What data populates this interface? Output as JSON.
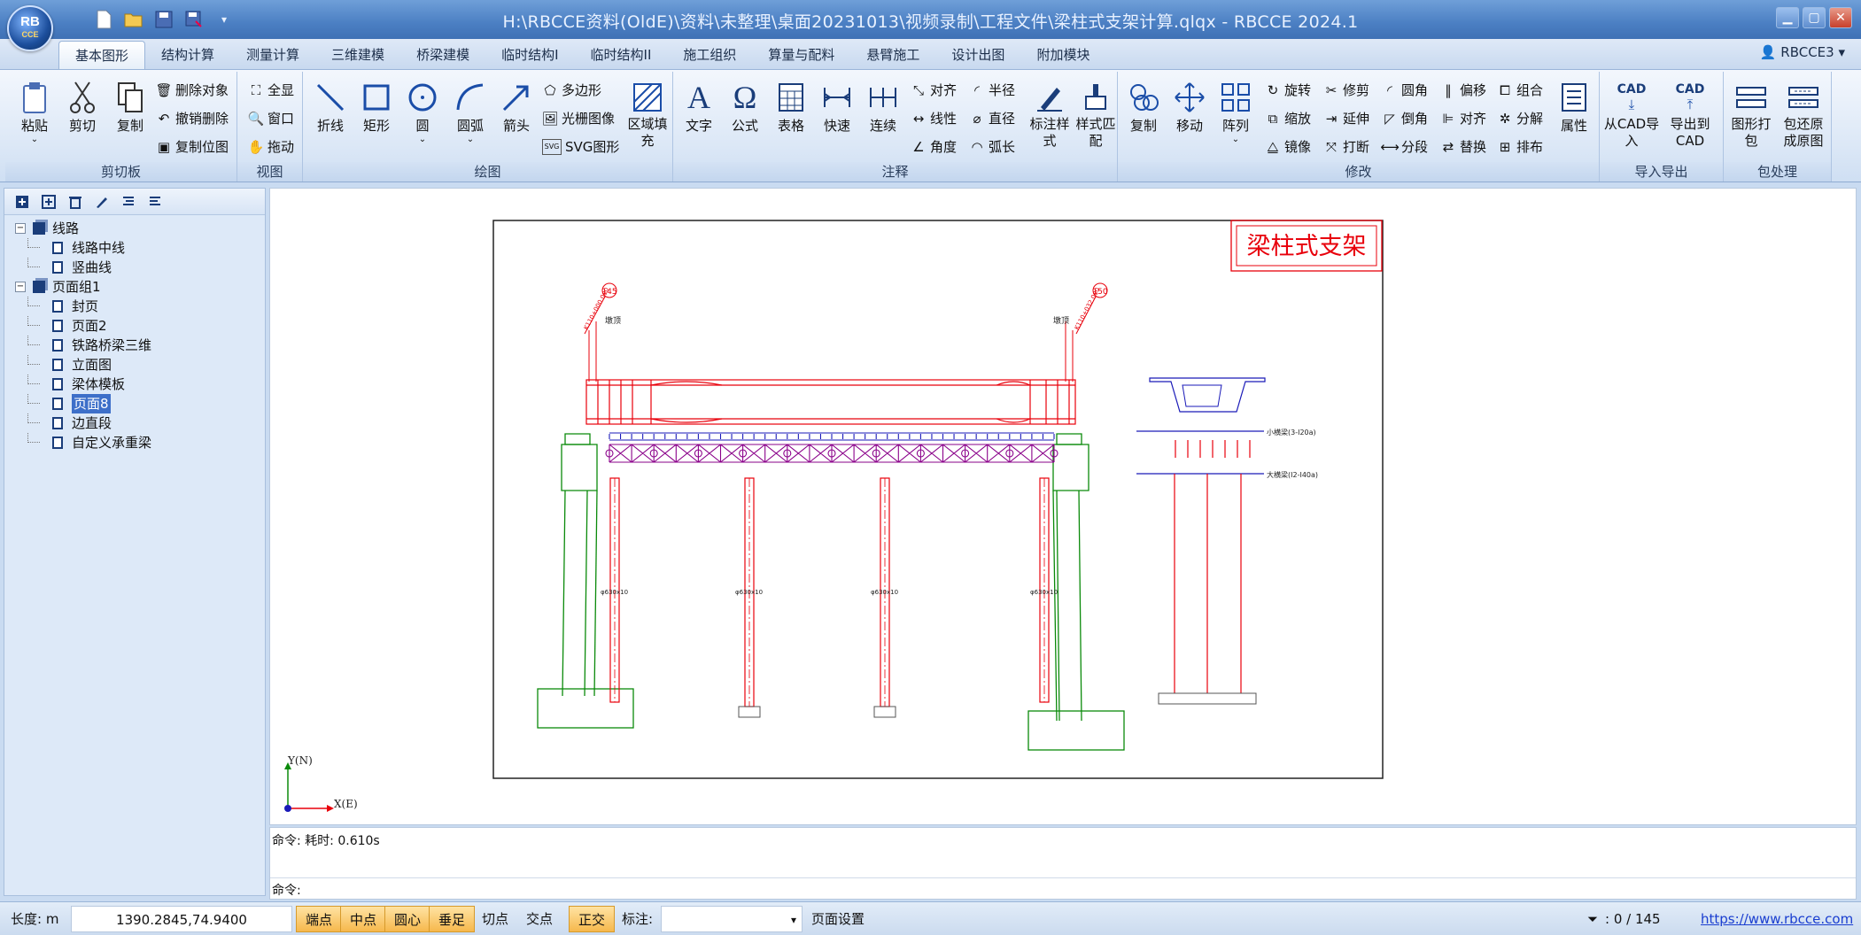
{
  "app": {
    "title": "H:\\RBCCE资料(OldE)\\资料\\未整理\\桌面20231013\\视频录制\\工程文件\\梁柱式支架计算.qlqx - RBCCE 2024.1",
    "logo_text": "RB",
    "logo_sub": "CCE"
  },
  "menu": {
    "tabs": [
      "基本图形",
      "结构计算",
      "测量计算",
      "三维建模",
      "桥梁建模",
      "临时结构I",
      "临时结构II",
      "施工组织",
      "算量与配料",
      "悬臂施工",
      "设计出图",
      "附加模块"
    ],
    "active_tab": "基本图形",
    "user": "RBCCE3"
  },
  "ribbon": {
    "clipboard": {
      "label": "剪切板",
      "paste": "粘贴",
      "cut": "剪切",
      "copy": "复制",
      "delete": "删除对象",
      "undo_delete": "撤销删除",
      "copy_pos": "复制位图"
    },
    "view": {
      "label": "视图",
      "full": "全显",
      "window": "窗口",
      "drag": "拖动"
    },
    "draw": {
      "label": "绘图",
      "polyline": "折线",
      "rect": "矩形",
      "circle": "圆",
      "arc": "圆弧",
      "arrow": "箭头",
      "polygon": "多边形",
      "raster": "光栅图像",
      "svg": "SVG图形",
      "fill": "区域填充"
    },
    "annot": {
      "label": "注释",
      "text": "文字",
      "formula": "公式",
      "table": "表格",
      "quick": "快速",
      "continuous": "连续",
      "align": "对齐",
      "linear": "线性",
      "angle": "角度",
      "radius": "半径",
      "diameter": "直径",
      "arclen": "弧长",
      "dim_style": "标注样式",
      "style_match": "样式匹配"
    },
    "modify": {
      "label": "修改",
      "copy": "复制",
      "move": "移动",
      "array": "阵列",
      "rotate": "旋转",
      "scale": "缩放",
      "mirror": "镜像",
      "trim": "修剪",
      "extend": "延伸",
      "break": "打断",
      "fillet": "圆角",
      "chamfer": "倒角",
      "divide": "分段",
      "offset": "偏移",
      "align": "对齐",
      "replace": "替换",
      "group": "组合",
      "explode": "分解",
      "order": "排布",
      "props": "属性"
    },
    "io": {
      "label": "导入导出",
      "from_cad": "从CAD导入",
      "to_cad": "导出到CAD",
      "cad_tag": "CAD"
    },
    "pack": {
      "label": "包处理",
      "pack": "图形打包",
      "unpack": "包还原成原图"
    }
  },
  "tree": {
    "nodes": [
      {
        "label": "线路",
        "level": 0,
        "expand": "−"
      },
      {
        "label": "线路中线",
        "level": 1
      },
      {
        "label": "竖曲线",
        "level": 1
      },
      {
        "label": "页面组1",
        "level": 0,
        "expand": "−"
      },
      {
        "label": "封页",
        "level": 1
      },
      {
        "label": "页面2",
        "level": 1
      },
      {
        "label": "铁路桥梁三维",
        "level": 1
      },
      {
        "label": "立面图",
        "level": 1
      },
      {
        "label": "梁体模板",
        "level": 1
      },
      {
        "label": "页面8",
        "level": 1,
        "selected": true
      },
      {
        "label": "边直段",
        "level": 1
      },
      {
        "label": "自定义承重梁",
        "level": 1
      }
    ]
  },
  "drawing": {
    "title": "梁柱式支架",
    "circle_left": "145",
    "circle_right": "150",
    "pier_label_left": "墩顶",
    "pier_label_right": "墩顶",
    "diag_left": "K110+000.000",
    "diag_right": "K110+032.000",
    "col_label": "φ630x10",
    "label_small_beam": "小横梁(3-I20a)",
    "label_big_beam": "大横梁(I2-I40a)",
    "axis_y": "Y(N)",
    "axis_x": "X(E)"
  },
  "command": {
    "history": "命令: 耗时: 0.610s",
    "prompt": "命令:"
  },
  "status": {
    "length_label": "长度: m",
    "coords": "1390.2845,74.9400",
    "snaps": [
      {
        "label": "端点",
        "on": true
      },
      {
        "label": "中点",
        "on": true
      },
      {
        "label": "圆心",
        "on": true
      },
      {
        "label": "垂足",
        "on": true
      },
      {
        "label": "切点",
        "on": false
      },
      {
        "label": "交点",
        "on": false
      },
      {
        "label": "正交",
        "on": true
      }
    ],
    "annot_label": "标注:",
    "page_setup": "页面设置",
    "count": ": 0 / 145",
    "url": "https://www.rbcce.com"
  },
  "colors": {
    "accent": "#3d6fc9",
    "red": "#e8000b",
    "green": "#0a8a0a",
    "purple": "#8a008a",
    "blue": "#1a1ab8"
  }
}
